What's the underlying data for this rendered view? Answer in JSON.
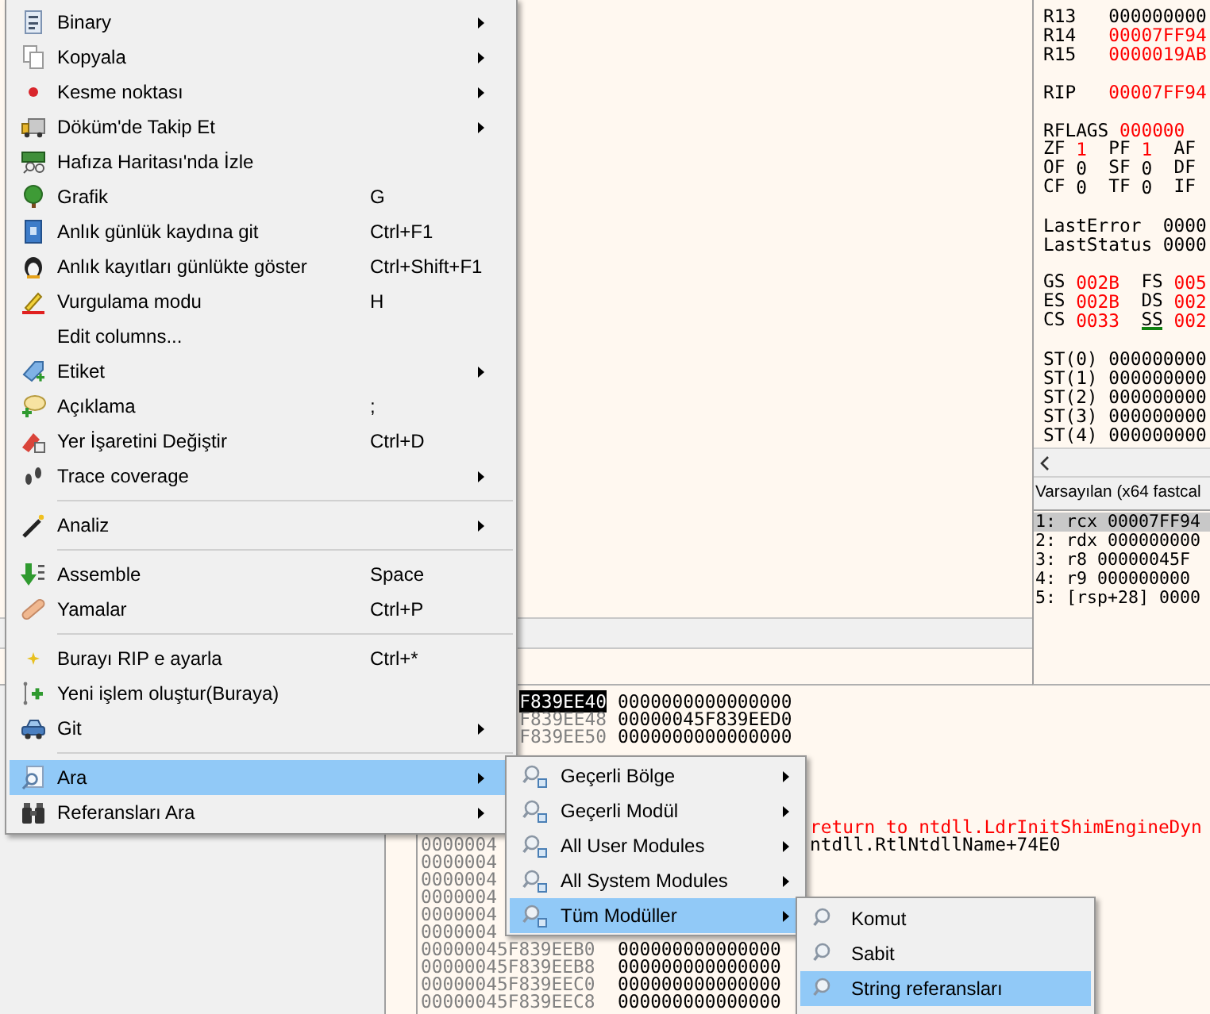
{
  "main_menu": {
    "items": [
      {
        "kind": "item",
        "label": "Binary",
        "submenu": true,
        "selected": false
      },
      {
        "kind": "item",
        "label": "Kopyala",
        "submenu": true,
        "selected": false
      },
      {
        "kind": "item",
        "label": "Kesme noktası",
        "submenu": true,
        "selected": false
      },
      {
        "kind": "item",
        "label": "Döküm'de Takip Et",
        "submenu": true,
        "selected": false
      },
      {
        "kind": "item",
        "label": "Hafıza Haritası'nda İzle",
        "submenu": false,
        "selected": false
      },
      {
        "kind": "item",
        "label": "Grafik",
        "shortcut": "G",
        "submenu": false,
        "selected": false
      },
      {
        "kind": "item",
        "label": "Anlık günlük kaydına git",
        "shortcut": "Ctrl+F1",
        "submenu": false,
        "selected": false
      },
      {
        "kind": "item",
        "label": "Anlık kayıtları günlükte göster",
        "shortcut": "Ctrl+Shift+F1",
        "submenu": false,
        "selected": false
      },
      {
        "kind": "item",
        "label": "Vurgulama modu",
        "shortcut": "H",
        "submenu": false,
        "selected": false
      },
      {
        "kind": "item",
        "label": "Edit columns...",
        "submenu": false,
        "selected": false
      },
      {
        "kind": "item",
        "label": "Etiket",
        "submenu": true,
        "selected": false
      },
      {
        "kind": "item",
        "label": "Açıklama",
        "shortcut": ";",
        "submenu": false,
        "selected": false
      },
      {
        "kind": "item",
        "label": "Yer İşaretini Değiştir",
        "shortcut": "Ctrl+D",
        "submenu": false,
        "selected": false
      },
      {
        "kind": "item",
        "label": "Trace coverage",
        "submenu": true,
        "selected": false
      },
      {
        "kind": "separator"
      },
      {
        "kind": "item",
        "label": "Analiz",
        "submenu": true,
        "selected": false
      },
      {
        "kind": "separator"
      },
      {
        "kind": "item",
        "label": "Assemble",
        "shortcut": "Space",
        "submenu": false,
        "selected": false
      },
      {
        "kind": "item",
        "label": "Yamalar",
        "shortcut": "Ctrl+P",
        "submenu": false,
        "selected": false
      },
      {
        "kind": "separator"
      },
      {
        "kind": "item",
        "label": "Burayı RIP e ayarla",
        "shortcut": "Ctrl+*",
        "submenu": false,
        "selected": false
      },
      {
        "kind": "item",
        "label": "Yeni işlem oluştur(Buraya)",
        "submenu": false,
        "selected": false
      },
      {
        "kind": "item",
        "label": "Git",
        "submenu": true,
        "selected": false
      },
      {
        "kind": "separator"
      },
      {
        "kind": "item",
        "label": "Ara",
        "submenu": true,
        "selected": true
      },
      {
        "kind": "item",
        "label": "Referansları Ara",
        "submenu": true,
        "selected": false
      }
    ]
  },
  "search_submenu": {
    "items": [
      {
        "label": "Geçerli Bölge",
        "submenu": true,
        "selected": false
      },
      {
        "label": "Geçerli Modül",
        "submenu": true,
        "selected": false
      },
      {
        "label": "All User Modules",
        "submenu": true,
        "selected": false
      },
      {
        "label": "All System Modules",
        "submenu": true,
        "selected": false
      },
      {
        "label": "Tüm Modüller",
        "submenu": true,
        "selected": true
      }
    ]
  },
  "modules_submenu": {
    "items": [
      {
        "label": "Komut",
        "submenu": false,
        "selected": false
      },
      {
        "label": "Sabit",
        "submenu": false,
        "selected": false
      },
      {
        "label": "String referansları",
        "submenu": false,
        "selected": true
      }
    ]
  },
  "registers": {
    "groups": [
      {
        "rows": [
          {
            "kind": "pair",
            "label": "R13",
            "value": "000000000",
            "changed": false
          },
          {
            "kind": "pair",
            "label": "R14",
            "value": "00007FF94",
            "changed": true
          },
          {
            "kind": "pair",
            "label": "R15",
            "value": "0000019AB",
            "changed": true
          }
        ]
      },
      {
        "rows": [
          {
            "kind": "pair",
            "label": "RIP",
            "value": "00007FF94",
            "changed": true
          }
        ]
      },
      {
        "rows": [
          {
            "kind": "pair",
            "label": "RFLAGS",
            "value": "000000",
            "changed": true
          },
          {
            "kind": "flags",
            "entries": [
              {
                "name": "ZF",
                "value": "1",
                "changed": true
              },
              {
                "name": "PF",
                "value": "1",
                "changed": true
              },
              {
                "name": "AF"
              }
            ]
          },
          {
            "kind": "flags",
            "entries": [
              {
                "name": "OF",
                "value": "0",
                "changed": false
              },
              {
                "name": "SF",
                "value": "0",
                "changed": false
              },
              {
                "name": "DF"
              }
            ]
          },
          {
            "kind": "flags",
            "entries": [
              {
                "name": "CF",
                "value": "0",
                "changed": false
              },
              {
                "name": "TF",
                "value": "0",
                "changed": false
              },
              {
                "name": "IF"
              }
            ]
          }
        ]
      },
      {
        "rows": [
          {
            "kind": "pair",
            "label": "LastError",
            "value": "0000",
            "changed": false
          },
          {
            "kind": "pair",
            "label": "LastStatus",
            "value": "0000",
            "changed": false
          }
        ]
      },
      {
        "rows": [
          {
            "kind": "segs",
            "entries": [
              {
                "name": "GS",
                "value": "002B",
                "changed": true,
                "underlined": false
              },
              {
                "name": "FS",
                "value": "005",
                "changed": true,
                "underlined": false
              }
            ]
          },
          {
            "kind": "segs",
            "entries": [
              {
                "name": "ES",
                "value": "002B",
                "changed": true,
                "underlined": false
              },
              {
                "name": "DS",
                "value": "002",
                "changed": true,
                "underlined": false
              }
            ]
          },
          {
            "kind": "segs",
            "entries": [
              {
                "name": "CS",
                "value": "0033",
                "changed": true,
                "underlined": false
              },
              {
                "name": "SS",
                "value": "002",
                "changed": true,
                "underlined": true
              }
            ]
          }
        ]
      },
      {
        "rows": [
          {
            "kind": "pair",
            "label": "ST(0)",
            "value": "000000000",
            "changed": false
          },
          {
            "kind": "pair",
            "label": "ST(1)",
            "value": "000000000",
            "changed": false
          },
          {
            "kind": "pair",
            "label": "ST(2)",
            "value": "000000000",
            "changed": false
          },
          {
            "kind": "pair",
            "label": "ST(3)",
            "value": "000000000",
            "changed": false
          },
          {
            "kind": "pair",
            "label": "ST(4)",
            "value": "000000000",
            "changed": false
          }
        ]
      }
    ]
  },
  "call_stack": {
    "header": "Varsayılan (x64 fastcal",
    "rows": [
      {
        "text": "1: rcx 00007FF94",
        "selected": true
      },
      {
        "text": "2: rdx 000000000",
        "selected": false
      },
      {
        "text": "3: r8 00000045F",
        "selected": false
      },
      {
        "text": "4: r9 000000000",
        "selected": false
      },
      {
        "text": "5: [rsp+28] 0000",
        "selected": false
      }
    ]
  },
  "stack": {
    "top_rows": [
      {
        "address": "F839EE40",
        "value": "0000000000000000",
        "selected": true
      },
      {
        "address": "F839EE48",
        "value": "00000045F839EED0",
        "selected": false
      },
      {
        "address": "F839EE50",
        "value": "0000000000000000",
        "selected": false
      }
    ],
    "rows": [
      {
        "comment": {
          "text": "return to ntdll.LdrInitShimEngineDyn",
          "kind": "return"
        }
      },
      {
        "address": "0000004",
        "comment": {
          "text": "ntdll.RtlNtdllName+74E0",
          "kind": "label"
        }
      },
      {
        "address": "0000004"
      },
      {
        "address": "0000004"
      },
      {
        "address": "0000004"
      },
      {
        "address": "0000004"
      },
      {
        "address": "0000004"
      },
      {
        "address": "00000045F839EEB0",
        "value": "000000000000000"
      },
      {
        "address": "00000045F839EEB8",
        "value": "000000000000000"
      },
      {
        "address": "00000045F839EEC0",
        "value": "000000000000000"
      },
      {
        "address": "00000045F839EEC8",
        "value": "000000000000000"
      }
    ]
  }
}
